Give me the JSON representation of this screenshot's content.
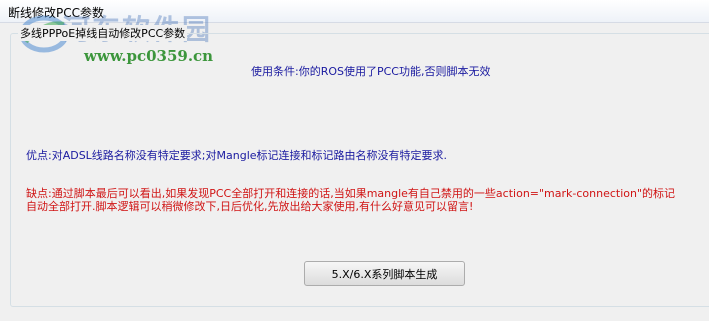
{
  "window": {
    "title": "断线修改PCC参数"
  },
  "watermark": {
    "name": "河东软件园",
    "url": "www.pc0359.cn"
  },
  "group": {
    "label": "多线PPPoE掉线自动修改PCC参数"
  },
  "texts": {
    "condition": "使用条件:你的ROS使用了PCC功能,否则脚本无效",
    "advantage": "优点:对ADSL线路名称没有特定要求;对Mangle标记连接和标记路由名称没有特定要求.",
    "disadvantage_line1": "缺点:通过脚本最后可以看出,如果发现PCC全部打开和连接的话,当如果mangle有自己禁用的一些action=\"mark-connection\"的标记",
    "disadvantage_line2": "自动全部打开.脚本逻辑可以稍微修改下,日后优化,先放出给大家使用,有什么好意见可以留言!"
  },
  "buttons": {
    "generate_label": "5.X/6.X系列脚本生成"
  }
}
